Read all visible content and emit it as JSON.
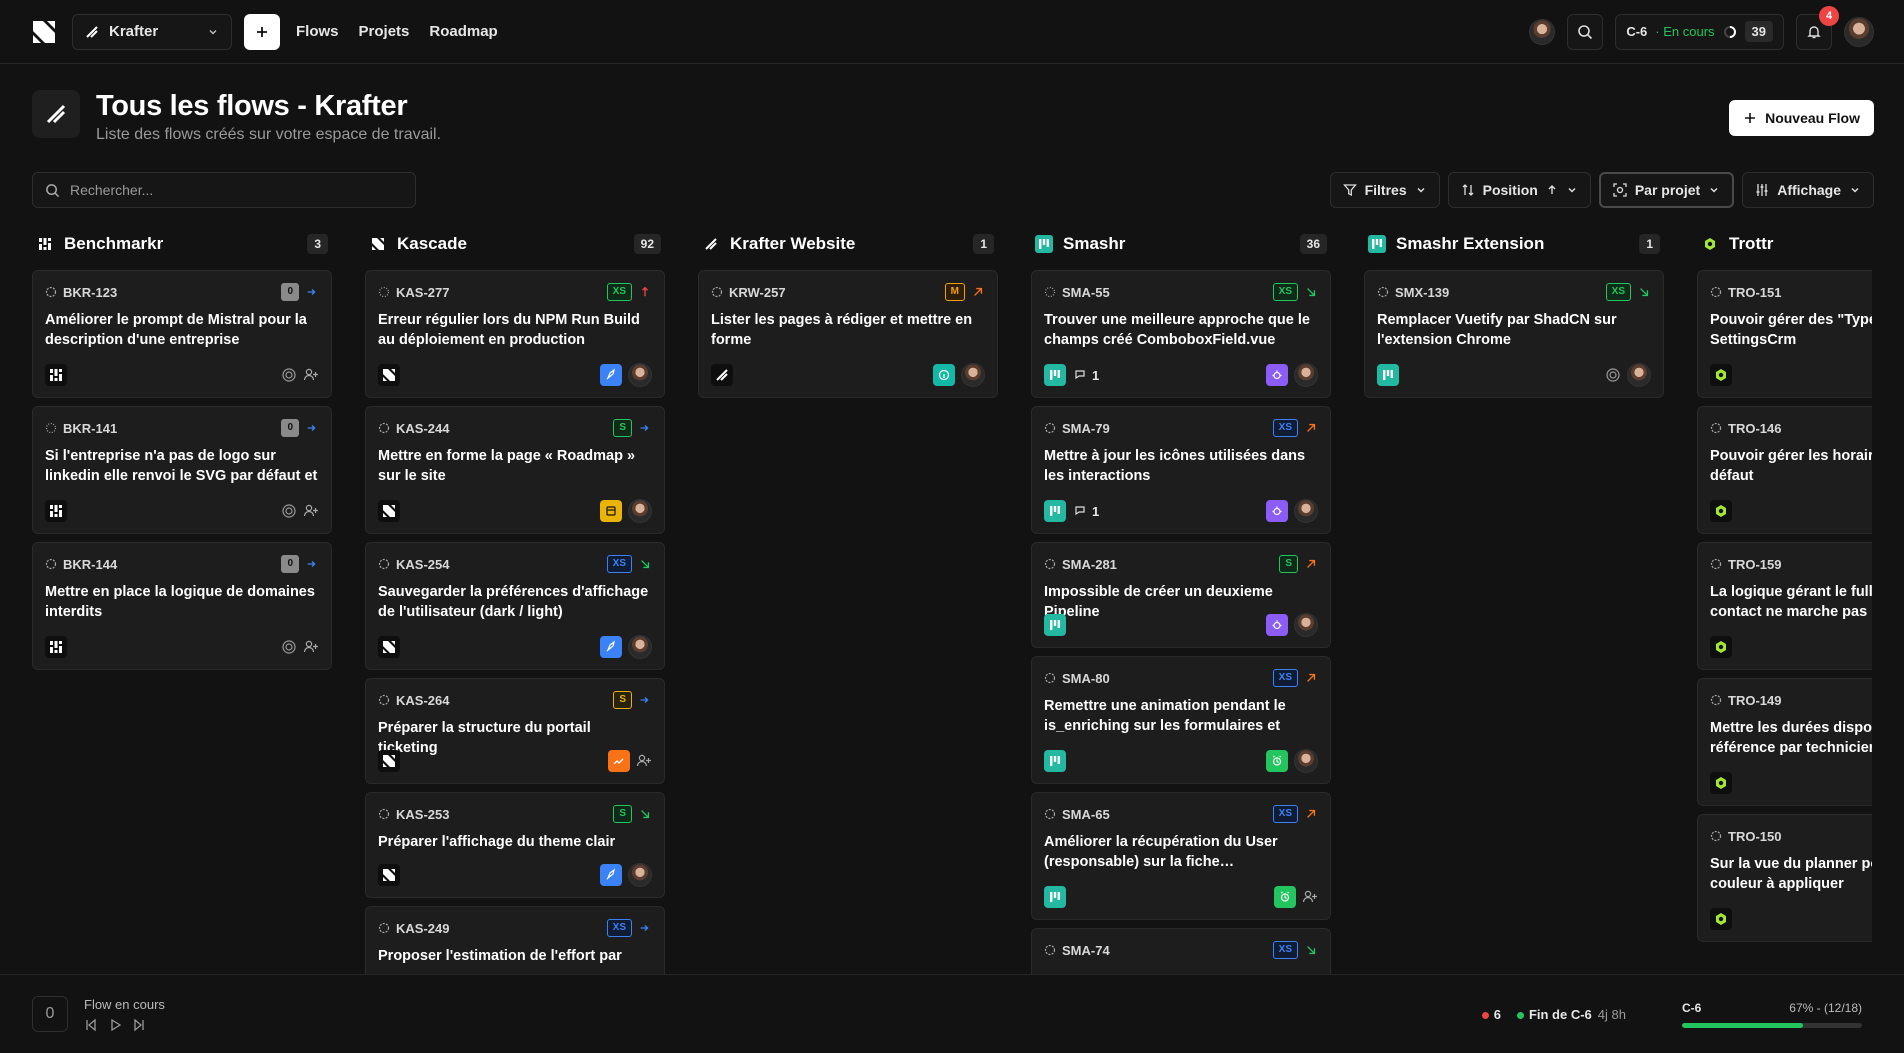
{
  "nav": {
    "workspace": "Krafter",
    "links": [
      "Flows",
      "Projets",
      "Roadmap"
    ],
    "cycle": {
      "name": "C-6",
      "status": "· En cours",
      "count": "39"
    },
    "notifications": "4"
  },
  "header": {
    "title": "Tous les flows - Krafter",
    "subtitle": "Liste des flows créés sur votre espace de travail.",
    "new_button": "Nouveau Flow"
  },
  "search": {
    "placeholder": "Rechercher..."
  },
  "filters": {
    "filters": "Filtres",
    "sort": "Position",
    "group": "Par projet",
    "display": "Affichage"
  },
  "columns": [
    {
      "name": "Benchmarkr",
      "count": "3",
      "icon": "benchmarkr-icon",
      "cards": [
        {
          "id": "BKR-123",
          "status": "todo",
          "size": "0",
          "prio": "low",
          "title": "Améliorer le prompt de Mistral pour la description d'une entreprise",
          "tag": "none",
          "assignee": "none"
        },
        {
          "id": "BKR-141",
          "status": "backlog",
          "size": "0",
          "prio": "low",
          "title": "Si l'entreprise n'a pas de logo sur linkedin elle renvoi le SVG par défaut et il ne faut…",
          "tag": "none",
          "assignee": "none"
        },
        {
          "id": "BKR-144",
          "status": "todo",
          "size": "0",
          "prio": "low",
          "title": "Mettre en place la logique de domaines interdits",
          "tag": "none",
          "assignee": "none"
        }
      ]
    },
    {
      "name": "Kascade",
      "count": "92",
      "icon": "kascade-icon",
      "cards": [
        {
          "id": "KAS-277",
          "status": "backlog",
          "size": "XS",
          "prio": "urgent",
          "title": "Erreur régulier lors du NPM Run Build au déploiement en production",
          "tag": "rocket",
          "assignee": "user"
        },
        {
          "id": "KAS-244",
          "status": "todo",
          "size": "S",
          "prio": "low",
          "title": "Mettre en forme la page « Roadmap » sur le site",
          "tag": "yellow",
          "assignee": "user"
        },
        {
          "id": "KAS-254",
          "status": "todo",
          "size": "XS",
          "prio": "none",
          "title": "Sauvegarder la préférences d'affichage de l'utilisateur (dark / light)",
          "tag": "rocket",
          "assignee": "user"
        },
        {
          "id": "KAS-264",
          "status": "todo",
          "size": "S",
          "prio": "low",
          "title": "Préparer la structure du portail ticketing",
          "tag": "orange",
          "assignee": "none",
          "short": true
        },
        {
          "id": "KAS-253",
          "status": "todo",
          "size": "S",
          "prio": "none",
          "title": "Préparer l'affichage du theme clair",
          "tag": "rocket",
          "assignee": "user",
          "short": true
        },
        {
          "id": "KAS-249",
          "status": "todo",
          "size": "XS",
          "prio": "low",
          "title": "Proposer l'estimation de l'effort par",
          "tag": "orange",
          "assignee": "none"
        }
      ]
    },
    {
      "name": "Krafter Website",
      "count": "1",
      "icon": "krafter-icon",
      "cards": [
        {
          "id": "KRW-257",
          "status": "todo",
          "size": "M",
          "prio": "high",
          "title": "Lister les pages à rédiger et mettre en forme",
          "tag": "teal",
          "assignee": "user"
        }
      ]
    },
    {
      "name": "Smashr",
      "count": "36",
      "icon": "smashr-icon",
      "cards": [
        {
          "id": "SMA-55",
          "status": "backlog",
          "size": "XS",
          "prio": "none",
          "title": "Trouver une meilleure approche que le champs créé ComboboxField.vue",
          "tag": "bug",
          "assignee": "user",
          "comments": "1"
        },
        {
          "id": "SMA-79",
          "status": "todo",
          "size": "XS",
          "prio": "high",
          "title": "Mettre à jour les icônes utilisées dans les interactions",
          "tag": "bug",
          "assignee": "user",
          "comments": "1"
        },
        {
          "id": "SMA-281",
          "status": "todo",
          "size": "S",
          "prio": "high",
          "title": "Impossible de créer un deuxieme Pipeline",
          "tag": "bug",
          "assignee": "user",
          "short": true
        },
        {
          "id": "SMA-80",
          "status": "todo",
          "size": "XS",
          "prio": "high",
          "title": "Remettre une animation pendant le is_enriching sur les formulaires et les…",
          "tag": "green",
          "assignee": "user"
        },
        {
          "id": "SMA-65",
          "status": "todo",
          "size": "XS",
          "prio": "high",
          "title": "Améliorer la récupération du User (responsable) sur la fiche…",
          "tag": "green",
          "assignee": "none"
        },
        {
          "id": "SMA-74",
          "status": "todo",
          "size": "XS",
          "prio": "none",
          "title": "",
          "tag": "bug",
          "assignee": "none"
        }
      ]
    },
    {
      "name": "Smashr Extension",
      "count": "1",
      "icon": "smashr-icon",
      "cards": [
        {
          "id": "SMX-139",
          "status": "todo",
          "size": "XS",
          "prio": "none",
          "title": "Remplacer Vuetify par ShadCN sur l'extension Chrome",
          "tag": "none",
          "assignee": "user",
          "target": true
        }
      ]
    },
    {
      "name": "Trottr",
      "count": "",
      "icon": "trottr-icon",
      "cards": [
        {
          "id": "TRO-151",
          "status": "todo",
          "size": "",
          "prio": "",
          "title": "Pouvoir gérer des \"Types de lot vue SettingsCrm",
          "tag": "none",
          "assignee": "none"
        },
        {
          "id": "TRO-146",
          "status": "todo",
          "size": "",
          "prio": "",
          "title": "Pouvoir gérer les horaires de l'e par défaut",
          "tag": "none",
          "assignee": "none"
        },
        {
          "id": "TRO-159",
          "status": "todo",
          "size": "",
          "prio": "",
          "title": "La logique gérant le full_name s contact ne marche pas pour les",
          "tag": "none",
          "assignee": "none"
        },
        {
          "id": "TRO-149",
          "status": "todo",
          "size": "",
          "prio": "",
          "title": "Mettre les durées disponible pa de référence par technicien",
          "tag": "none",
          "assignee": "none"
        },
        {
          "id": "TRO-150",
          "status": "todo",
          "size": "",
          "prio": "",
          "title": "Sur la vue du planner pouvoir c code couleur à appliquer",
          "tag": "none",
          "assignee": "none"
        }
      ]
    }
  ],
  "bottom": {
    "timer": "0",
    "flow_label": "Flow en cours",
    "red_count": "6",
    "end_label": "Fin de C-6",
    "end_time": "4j 8h",
    "cycle": "C-6",
    "progress_label": "67% - (12/18)",
    "progress": 0.67
  },
  "colors": {
    "accent": "#22c55e",
    "teal": "#22b8a2",
    "danger": "#ef4444"
  }
}
